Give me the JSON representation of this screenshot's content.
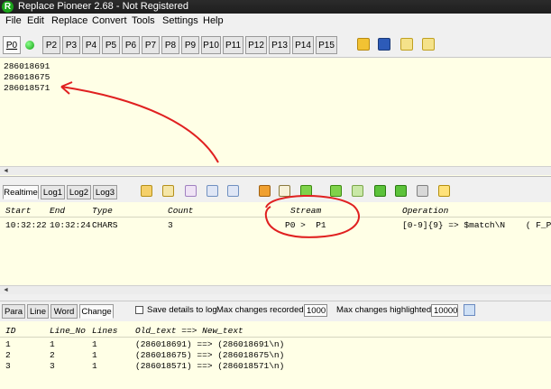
{
  "window": {
    "title": "Replace Pioneer 2.68 - Not Registered",
    "app_icon": "R"
  },
  "menu": [
    "File",
    "Edit",
    "Replace",
    "Convert",
    "Tools",
    "Settings",
    "Help"
  ],
  "pipe_tabs": [
    "P0",
    "P2",
    "P3",
    "P4",
    "P5",
    "P6",
    "P7",
    "P8",
    "P9",
    "P10",
    "P11",
    "P12",
    "P13",
    "P14",
    "P15"
  ],
  "editor": {
    "lines": [
      "286018691",
      "286018675",
      "286018571"
    ]
  },
  "log_tabs": [
    "Realtime",
    "Log1",
    "Log2",
    "Log3"
  ],
  "log": {
    "columns": [
      "Start",
      "End",
      "Type",
      "Count",
      "Stream",
      "Operation"
    ],
    "rows": [
      {
        "start": "10:32:22",
        "end": "10:32:24",
        "type": "CHARS",
        "count": "3",
        "stream": "P0 >  P1",
        "operation": "[0-9]{9} => $match\\N    ( F_P_U"
      }
    ]
  },
  "detail_tabs": [
    "Para",
    "Line",
    "Word",
    "Change"
  ],
  "controls": {
    "save_details_label": "Save details to log",
    "max_recorded_label": "Max changes recorded=>",
    "max_recorded_value": "1000",
    "max_highlighted_label": "Max changes highlighted=>",
    "max_highlighted_value": "10000"
  },
  "changes": {
    "columns": [
      "ID",
      "Line_No",
      "Lines",
      "Old_text ==> New_text"
    ],
    "rows": [
      {
        "id": "1",
        "line_no": "1",
        "lines": "1",
        "text": "(286018691) ==> (286018691\\n)"
      },
      {
        "id": "2",
        "line_no": "2",
        "lines": "1",
        "text": "(286018675) ==> (286018675\\n)"
      },
      {
        "id": "3",
        "line_no": "3",
        "lines": "1",
        "text": "(286018571) ==> (286018571\\n)"
      }
    ]
  },
  "colors": {
    "pane_background": "#ffffe6",
    "annotation": "#e02020",
    "status_dot": "#19b219"
  }
}
